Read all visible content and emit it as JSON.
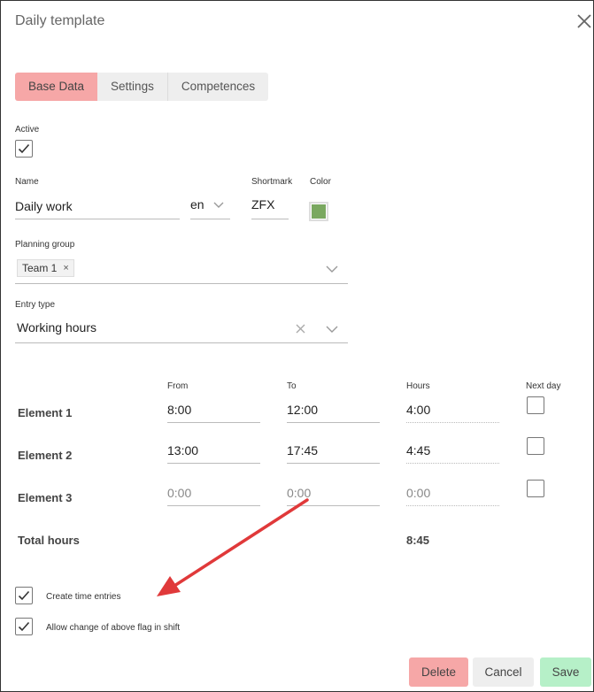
{
  "dialog": {
    "title": "Daily template"
  },
  "tabs": [
    {
      "label": "Base Data",
      "active": true
    },
    {
      "label": "Settings",
      "active": false
    },
    {
      "label": "Competences",
      "active": false
    }
  ],
  "active": {
    "label": "Active",
    "checked": true
  },
  "name": {
    "label": "Name",
    "value": "Daily work",
    "language": "en"
  },
  "shortmark": {
    "label": "Shortmark",
    "value": "ZFX"
  },
  "color": {
    "label": "Color",
    "value": "#7aa860"
  },
  "planning_group": {
    "label": "Planning group",
    "chips": [
      "Team 1"
    ],
    "chip_remove": "×"
  },
  "entry_type": {
    "label": "Entry type",
    "value": "Working hours"
  },
  "elements": {
    "headers": {
      "from": "From",
      "to": "To",
      "hours": "Hours",
      "next_day": "Next day"
    },
    "rows": [
      {
        "label": "Element 1",
        "from": "8:00",
        "to": "12:00",
        "hours": "4:00",
        "next_day": false,
        "placeholder": false
      },
      {
        "label": "Element 2",
        "from": "13:00",
        "to": "17:45",
        "hours": "4:45",
        "next_day": false,
        "placeholder": false
      },
      {
        "label": "Element 3",
        "from": "0:00",
        "to": "0:00",
        "hours": "0:00",
        "next_day": false,
        "placeholder": true
      }
    ],
    "total": {
      "label": "Total hours",
      "value": "8:45"
    }
  },
  "options": [
    {
      "label": "Create time entries",
      "checked": true
    },
    {
      "label": "Allow change of above flag in shift",
      "checked": true
    }
  ],
  "buttons": {
    "delete": "Delete",
    "cancel": "Cancel",
    "save": "Save"
  },
  "colors": {
    "accent_red": "#f6a7a7",
    "save_green": "#b6f0c8",
    "arrow_red": "#e0393a"
  }
}
